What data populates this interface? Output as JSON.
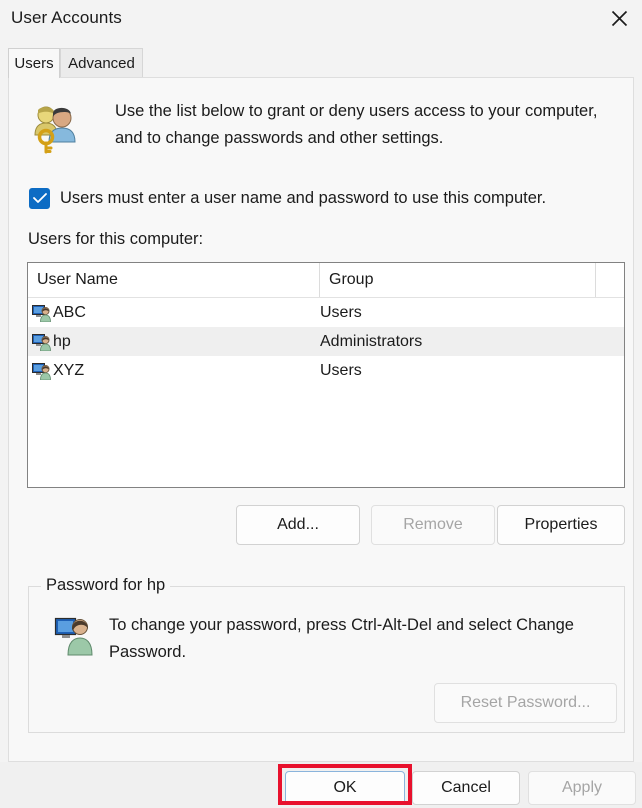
{
  "window": {
    "title": "User Accounts",
    "close_icon": "close-icon"
  },
  "tabs": [
    {
      "label": "Users",
      "selected": true
    },
    {
      "label": "Advanced",
      "selected": false
    }
  ],
  "main": {
    "description_icon": "users-key-icon",
    "description": "Use the list below to grant or deny users access to your computer, and to change passwords and other settings.",
    "checkbox": {
      "label": "Users must enter a user name and password to use this computer.",
      "checked": true,
      "accent_color": "#0d6cc4"
    },
    "list_label": "Users for this computer:",
    "list": {
      "columns": [
        "User Name",
        "Group",
        ""
      ],
      "rows": [
        {
          "icon": "user-account-icon",
          "name": "ABC",
          "group": "Users",
          "selected": false
        },
        {
          "icon": "user-account-icon",
          "name": "hp",
          "group": "Administrators",
          "selected": true
        },
        {
          "icon": "user-account-icon",
          "name": "XYZ",
          "group": "Users",
          "selected": false
        }
      ],
      "selected_row_color": "#efefef"
    },
    "buttons": {
      "add": {
        "label": "Add...",
        "disabled": false
      },
      "remove": {
        "label": "Remove",
        "disabled": true
      },
      "properties": {
        "label": "Properties",
        "disabled": false
      }
    },
    "password_group": {
      "title": "Password for hp",
      "icon": "user-password-icon",
      "text": "To change your password, press Ctrl-Alt-Del and select Change Password.",
      "reset_button": {
        "label": "Reset Password...",
        "disabled": true
      }
    }
  },
  "footer": {
    "ok": {
      "label": "OK",
      "disabled": false,
      "focused": true
    },
    "cancel": {
      "label": "Cancel",
      "disabled": false
    },
    "apply": {
      "label": "Apply",
      "disabled": true
    }
  },
  "annotation": {
    "highlight_color": "#e8112d",
    "target": "OK"
  }
}
